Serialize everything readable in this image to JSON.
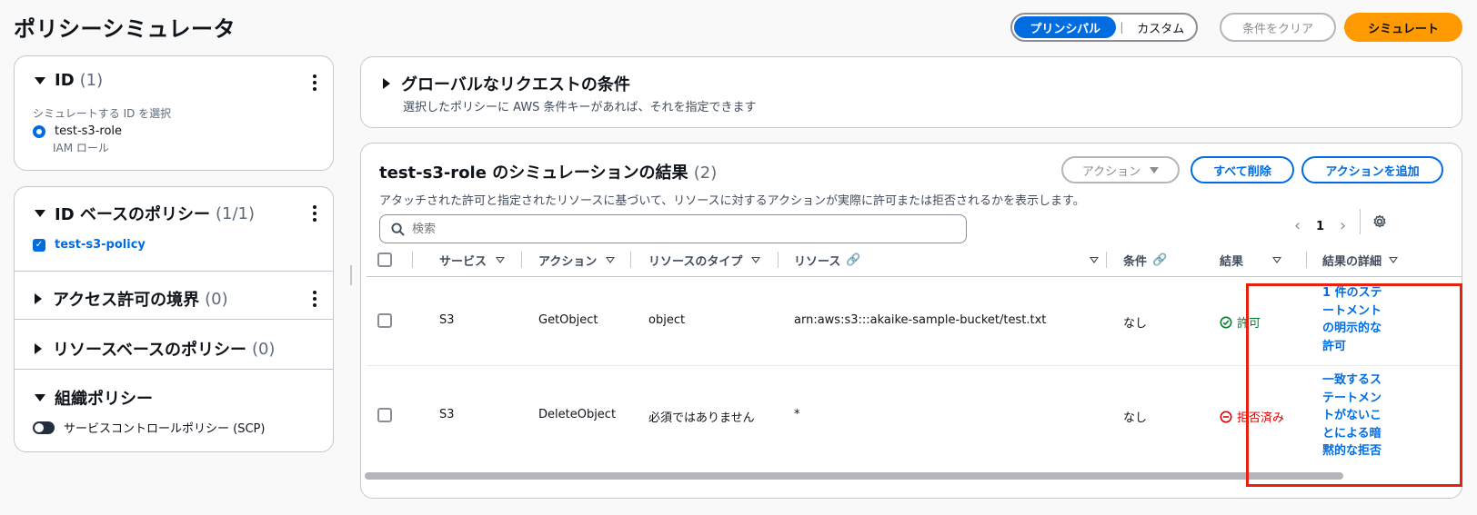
{
  "page": {
    "title": "ポリシーシミュレータ"
  },
  "toolbar": {
    "segment_principal": "プリンシパル",
    "segment_separator": "|",
    "segment_custom": "カスタム",
    "clear_label": "条件をクリア",
    "simulate_label": "シミュレート"
  },
  "identity": {
    "heading": "ID",
    "count": "(1)",
    "select_label": "シミュレートする ID を選択",
    "selected_name": "test-s3-role",
    "selected_type": "IAM ロール"
  },
  "policies": {
    "identity_heading": "ID ベースのポリシー",
    "identity_count": "(1/1)",
    "identity_item": "test-s3-policy",
    "boundary_heading": "アクセス許可の境界",
    "boundary_count": "(0)",
    "resource_heading": "リソースベースのポリシー",
    "resource_count": "(0)",
    "org_heading": "組織ポリシー",
    "scp_label": "サービスコントロールポリシー (SCP)"
  },
  "global_conditions": {
    "heading": "グローバルなリクエストの条件",
    "description": "選択したポリシーに AWS 条件キーがあれば、それを指定できます"
  },
  "results": {
    "title": "test-s3-role のシミュレーションの結果",
    "count": "(2)",
    "description": "アタッチされた許可と指定されたリソースに基づいて、リソースに対するアクションが実際に許可または拒否されるかを表示します。",
    "actions_label": "アクション",
    "delete_all_label": "すべて削除",
    "add_action_label": "アクションを追加",
    "search_placeholder": "検索",
    "page_number": "1",
    "columns": {
      "service": "サービス",
      "action": "アクション",
      "resource_type": "リソースのタイプ",
      "resource": "リソース",
      "condition": "条件",
      "result": "結果",
      "detail": "結果の詳細"
    },
    "rows": [
      {
        "service": "S3",
        "action": "GetObject",
        "resource_type": "object",
        "resource": "arn:aws:s3:::akaike-sample-bucket/test.txt",
        "condition": "なし",
        "result": "許可",
        "detail": "1 件のステートメントの明示的な許可"
      },
      {
        "service": "S3",
        "action": "DeleteObject",
        "resource_type": "必須ではありません",
        "resource": "*",
        "condition": "なし",
        "result": "拒否済み",
        "detail": "一致するステートメントがないことによる暗黙的な拒否"
      }
    ]
  },
  "colors": {
    "accent": "#006ce0",
    "simulate": "#ff9900",
    "allow": "#00802f",
    "deny": "#db0000",
    "highlight": "#e8210f"
  }
}
